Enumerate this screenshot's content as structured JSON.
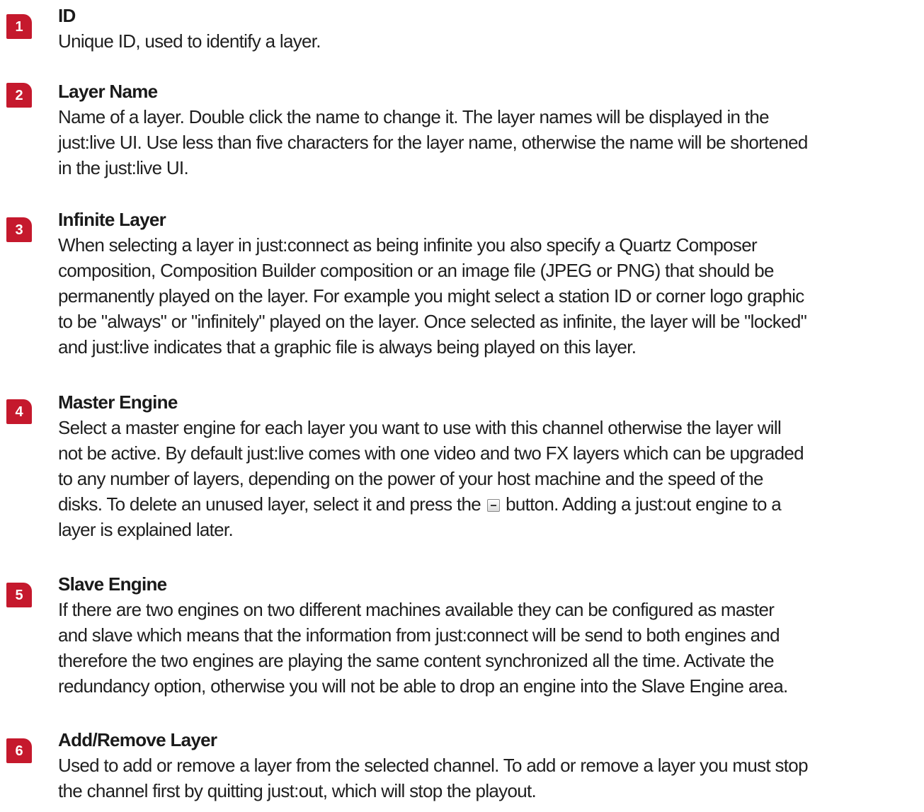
{
  "sections": [
    {
      "number": "1",
      "title": "ID",
      "lines": [
        "Unique ID, used to identify a layer."
      ]
    },
    {
      "number": "2",
      "title": "Layer Name",
      "lines": [
        "Name of a layer. Double click the name to change it. The layer names will be displayed in the",
        "just:live UI. Use less than five characters for the layer name, otherwise the name will be shortened",
        "in the just:live UI."
      ]
    },
    {
      "number": "3",
      "title": "Infinite Layer",
      "lines": [
        "When selecting a layer in just:connect as being infinite you also specify a Quartz Composer",
        "composition, Composition Builder composition or an image file (JPEG or PNG) that should be",
        "permanently played on the layer. For example you might select a station ID or corner logo graphic",
        "to be \"always\" or \"infinitely\" played on the layer. Once selected as infinite, the layer will be \"locked\"",
        "and just:live indicates that a graphic file is always being played on this layer."
      ]
    },
    {
      "number": "4",
      "title": "Master Engine",
      "lines": [
        "Select a master engine for each layer you want to use with this channel otherwise the layer will",
        "not be active. By default just:live comes with one video and two FX layers which can be upgraded",
        "to any number of layers, depending on the power of your host machine and the speed of the"
      ],
      "icon_line_before": "disks. To delete an unused layer, select it and press the",
      "icon": "minus-button-icon",
      "icon_line_after": "button. Adding a just:out engine to a",
      "last_line": "layer is explained later."
    },
    {
      "number": "5",
      "title": "Slave Engine",
      "lines": [
        "If there are two engines on two different machines available they can be configured as master",
        "and slave which means that the information from just:connect will be send to both engines and",
        "therefore the two engines are playing the same content synchronized all the time. Activate the",
        "redundancy option, otherwise you will not be able to drop an engine into the Slave Engine area."
      ]
    },
    {
      "number": "6",
      "title": "Add/Remove Layer",
      "lines": [
        "Used to add or remove a layer from the selected channel. To add or remove a layer you must stop",
        "the channel first by quitting just:out, which will stop the playout."
      ]
    }
  ]
}
